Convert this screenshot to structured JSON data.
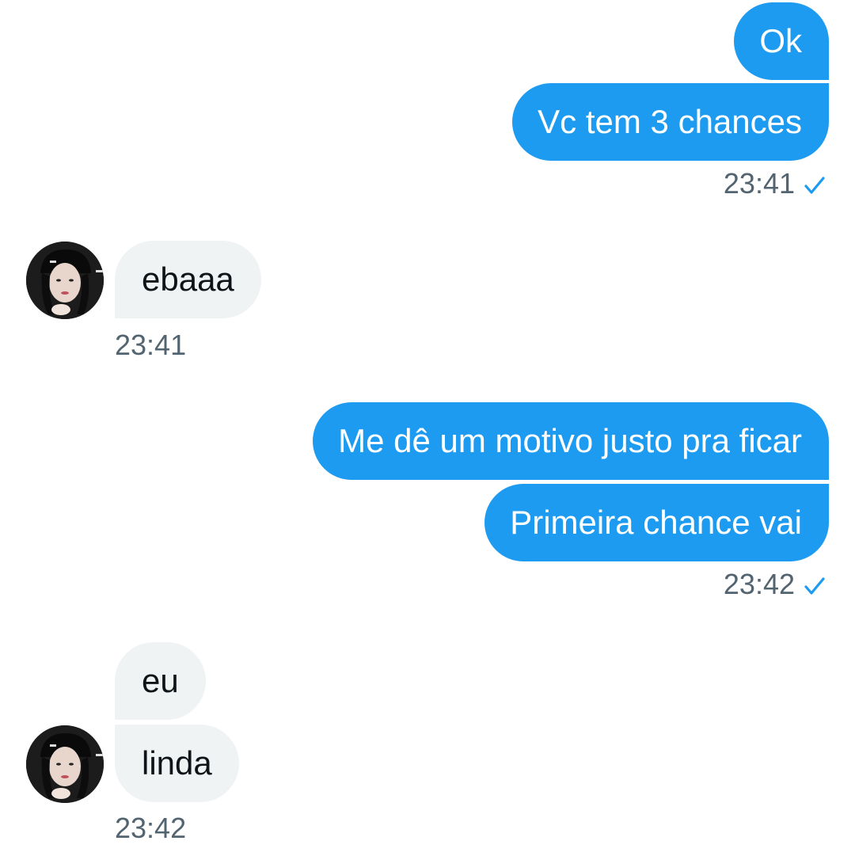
{
  "messages": {
    "m1": {
      "text": "Ok"
    },
    "m2": {
      "text": "Vc tem 3 chances"
    },
    "t1": {
      "time": "23:41"
    },
    "m3": {
      "text": "ebaaa"
    },
    "t2": {
      "time": "23:41"
    },
    "m4": {
      "text": "Me dê um motivo justo pra ficar"
    },
    "m5": {
      "text": "Primeira chance vai"
    },
    "t3": {
      "time": "23:42"
    },
    "m6": {
      "text": "eu"
    },
    "m7": {
      "text": "linda"
    },
    "t4": {
      "time": "23:42"
    }
  },
  "icons": {
    "read_receipt": "check-icon",
    "contact_avatar": "avatar"
  },
  "colors": {
    "outgoing_bubble": "#1d9bf0",
    "incoming_bubble": "#eff3f4",
    "timestamp": "#536471",
    "check": "#1d9bf0"
  }
}
